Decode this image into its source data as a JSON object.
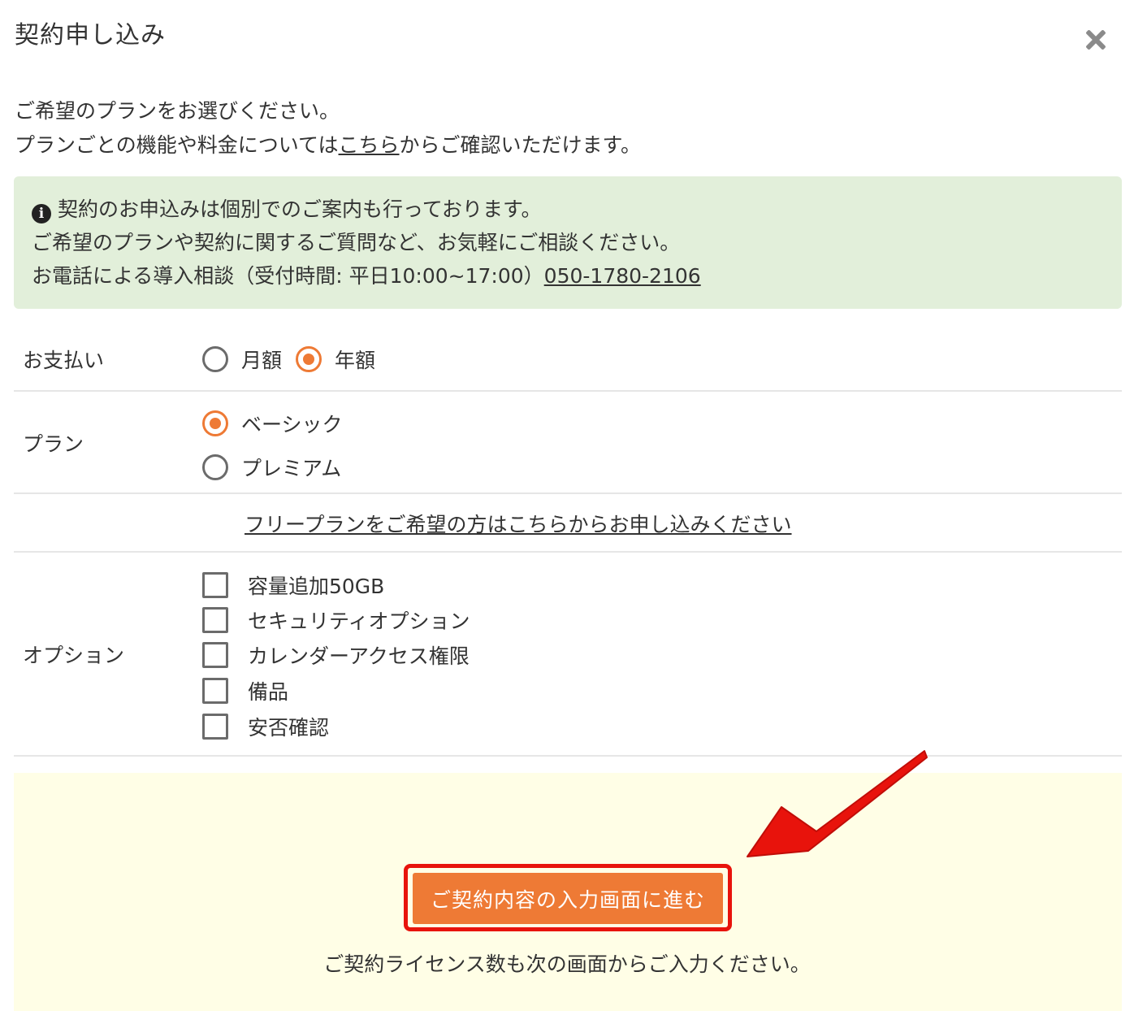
{
  "modal": {
    "title": "契約申し込み",
    "close_label": "×"
  },
  "intro": {
    "line1": "ご希望のプランをお選びください。",
    "line2_before": "プランごとの機能や料金については",
    "line2_link": "こちら",
    "line2_after": "からご確認いただけます。"
  },
  "info_box": {
    "icon": "info-icon",
    "line1": "契約のお申込みは個別でのご案内も行っております。",
    "line2": "ご希望のプランや契約に関するご質問など、お気軽にご相談ください。",
    "line3_before": "お電話による導入相談（受付時間: 平日10:00~17:00）",
    "phone": "050-1780-2106",
    "background": "#e2efda"
  },
  "payment": {
    "label": "お支払い",
    "options": [
      {
        "label": "月額",
        "selected": false
      },
      {
        "label": "年額",
        "selected": true
      }
    ]
  },
  "plan": {
    "label": "プラン",
    "options": [
      {
        "label": "ベーシック",
        "selected": true
      },
      {
        "label": "プレミアム",
        "selected": false
      }
    ]
  },
  "free_plan_link": "フリープランをご希望の方はこちらからお申し込みください",
  "options_section": {
    "label": "オプション",
    "items": [
      {
        "label": "容量追加50GB",
        "checked": false
      },
      {
        "label": "セキュリティオプション",
        "checked": false
      },
      {
        "label": "カレンダーアクセス権限",
        "checked": false
      },
      {
        "label": "備品",
        "checked": false
      },
      {
        "label": "安否確認",
        "checked": false
      }
    ]
  },
  "cta": {
    "button_label": "ご契約内容の入力画面に進む",
    "note": "ご契約ライセンス数も次の画面からご入力ください。",
    "background": "#fffee6",
    "button_color": "#ee7a35",
    "highlight_color": "#e8130c"
  },
  "colors": {
    "accent": "#ee7a35",
    "annotation_red": "#e8130c"
  }
}
